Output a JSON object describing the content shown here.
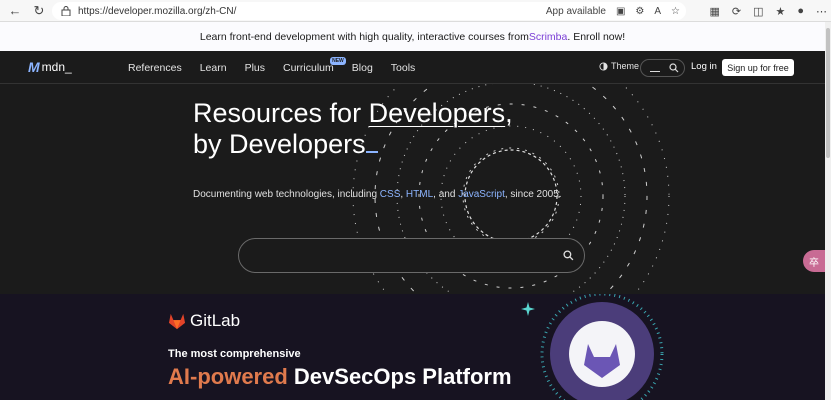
{
  "browser": {
    "url": "https://developer.mozilla.org/zh-CN/",
    "app_available": "App available"
  },
  "banner": {
    "text": "Learn front-end development with high quality, interactive courses from ",
    "link": "Scrimba",
    "suffix": ". Enroll now!"
  },
  "header": {
    "logo": "mdn_",
    "nav": [
      "References",
      "Learn",
      "Plus",
      "Curriculum",
      "Blog",
      "Tools"
    ],
    "new_badge": "NEW",
    "theme": "Theme",
    "login": "Log in",
    "signup": "Sign up for free"
  },
  "hero": {
    "title_line1_a": "Resources for ",
    "title_line1_b": "Developers",
    "title_line1_c": ",",
    "title_line2": "by Developers",
    "subtitle_a": "Documenting web technologies, including ",
    "subtitle_css": "CSS",
    "subtitle_sep1": ", ",
    "subtitle_html": "HTML",
    "subtitle_sep2": ", and ",
    "subtitle_js": "JavaScript",
    "subtitle_b": ", since 2005."
  },
  "ad": {
    "brand": "GitLab",
    "subtitle": "The most comprehensive",
    "title_accent": "AI-powered",
    "title_rest": " DevSecOps Platform"
  },
  "colors": {
    "accent": "#8cb4ff",
    "scrimba": "#7b3fd6",
    "gitlab_orange": "#e24329"
  }
}
